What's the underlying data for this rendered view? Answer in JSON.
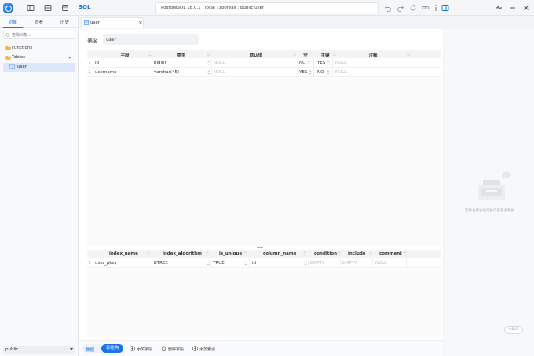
{
  "toolbar": {
    "sql_label": "SQL",
    "connection": "PostgreSQL 18.0.1 : local : zooreas : public.user"
  },
  "sidebar": {
    "tabs": [
      "对象",
      "查看",
      "历史"
    ],
    "search_placeholder": "查找对象...",
    "tree": [
      {
        "label": "Functions"
      },
      {
        "label": "Tables"
      },
      {
        "label": "user"
      }
    ],
    "schema": "public"
  },
  "tab": {
    "label": "user",
    "close": "×"
  },
  "table_name": {
    "label": "表名",
    "value": "user"
  },
  "columns_grid": {
    "headers": [
      "字段",
      "类型",
      "默认值",
      "空",
      "主键",
      "注释"
    ],
    "rows": [
      {
        "num": "1",
        "field": "id",
        "type": "bigint",
        "default": "NULL",
        "nullable": "NO",
        "pk": "YES",
        "comment": "NULL"
      },
      {
        "num": "2",
        "field": "username",
        "type": "varchar(45)",
        "default": "NULL",
        "nullable": "YES",
        "pk": "NO",
        "comment": "NULL"
      }
    ]
  },
  "index_grid": {
    "headers": [
      "index_name",
      "index_algorithm",
      "is_unique",
      "column_name",
      "condition",
      "include",
      "comment"
    ],
    "rows": [
      {
        "num": "1",
        "index_name": "user_pkey",
        "algorithm": "BTREE",
        "unique": "TRUE",
        "column": "id",
        "condition": "EMPTY",
        "include": "EMPTY",
        "comment": "NULL"
      }
    ]
  },
  "bottom": {
    "data_tab": "数据",
    "structure_tab": "表结构",
    "add_field": "添加字段",
    "delete_field": "删除字段",
    "add_index": "添加索引"
  },
  "right_panel": {
    "empty_text": "选择左侧表格或执行查看表数据",
    "help": "HELP"
  },
  "colors": {
    "accent": "#1a73e8",
    "selected": "#dbe8fb"
  },
  "icons": [
    "panel-left-icon",
    "layout-icon",
    "database-icon",
    "undo-icon",
    "redo-icon",
    "refresh-icon",
    "link-icon",
    "more-icon",
    "sidebar-toggle-icon",
    "pulse-icon",
    "minimize-icon",
    "close-icon"
  ]
}
